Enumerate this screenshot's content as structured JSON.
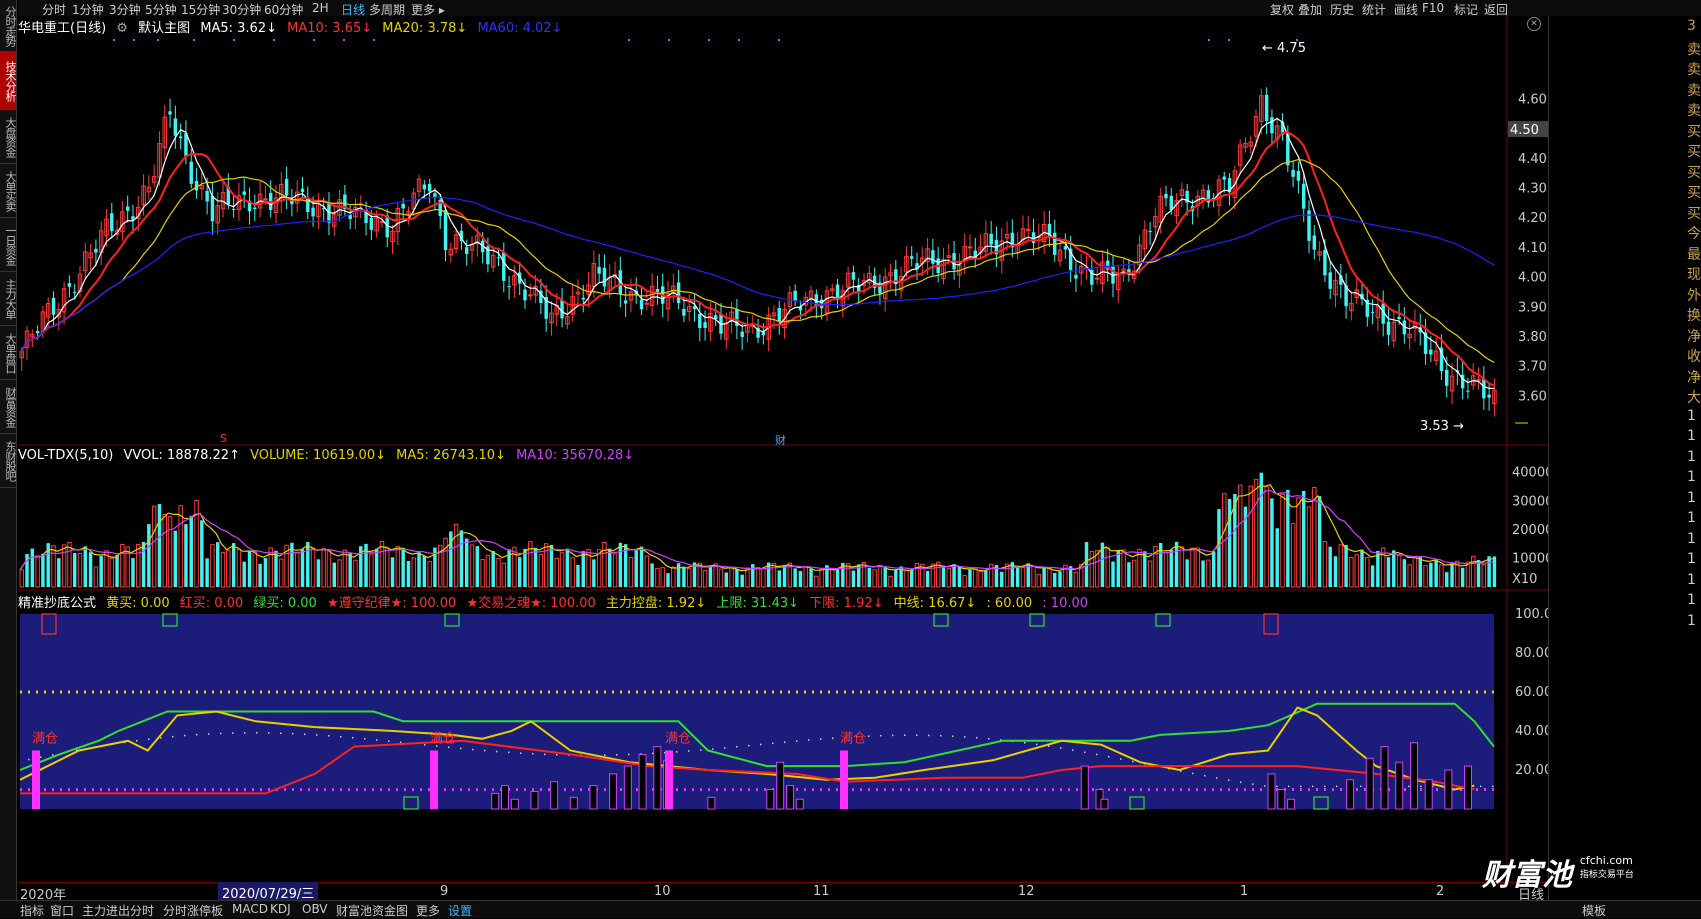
{
  "left_tabs": [
    {
      "label": "分时走势",
      "active": false
    },
    {
      "label": "技术分析",
      "active": true
    },
    {
      "label": "大盘资金",
      "active": false
    },
    {
      "label": "大单买卖",
      "active": false
    },
    {
      "label": "一日资金",
      "active": false
    },
    {
      "label": "主力大单",
      "active": false
    },
    {
      "label": "大单盘口",
      "active": false
    },
    {
      "label": "财富资金",
      "active": false
    },
    {
      "label": "东财股吧",
      "active": false
    }
  ],
  "periods": [
    {
      "label": "分时",
      "active": false
    },
    {
      "label": "1分钟",
      "active": false
    },
    {
      "label": "3分钟",
      "active": false
    },
    {
      "label": "5分钟",
      "active": false
    },
    {
      "label": "15分钟",
      "active": false
    },
    {
      "label": "30分钟",
      "active": false
    },
    {
      "label": "60分钟",
      "active": false
    },
    {
      "label": "2H",
      "active": false
    },
    {
      "label": "日线",
      "active": true
    },
    {
      "label": "多周期",
      "active": false
    },
    {
      "label": "更多 ▸",
      "active": false
    }
  ],
  "toolbar_right": [
    "复权",
    "叠加",
    "历史",
    "统计",
    "画线",
    "F10",
    "标记",
    "返回"
  ],
  "main_legend": {
    "stock": "华电重工(日线)",
    "chart_mode": "默认主图",
    "ma5": "MA5: 3.62↓",
    "ma10": "MA10: 3.65↓",
    "ma20": "MA20: 3.78↓",
    "ma60": "MA60: 4.02↓"
  },
  "price_axis": [
    "4.60",
    "4.50",
    "4.40",
    "4.30",
    "4.20",
    "4.10",
    "4.00",
    "3.90",
    "3.80",
    "3.70",
    "3.60"
  ],
  "price_current": "4.50",
  "annotations": {
    "high": "4.75",
    "low": "3.53",
    "s_mark": "S",
    "cai_mark": "财"
  },
  "vol_legend": {
    "name": "VOL-TDX(5,10)",
    "vvol": "VVOL: 18878.22↑",
    "volume": "VOLUME: 10619.00↓",
    "ma5": "MA5: 26743.10↓",
    "ma10": "MA10: 35670.28↓"
  },
  "vol_axis": [
    "40000",
    "30000",
    "20000",
    "10000",
    "X10"
  ],
  "ind_legend": {
    "name": "精准抄底公式",
    "huang": "黄买: 0.00",
    "hong": "红买: 0.00",
    "lv": "绿买: 0.00",
    "zun": "★遵守纪律★: 100.00",
    "hun": "★交易之魂★: 100.00",
    "zhuli": "主力控盘: 1.92↓",
    "shang": "上限: 31.43↓",
    "xia": "下限: 1.92↓",
    "zhong": "中线: 16.67↓",
    "sixty": ": 60.00",
    "ten": ": 10.00"
  },
  "ind_axis": [
    "100.0",
    "80.00",
    "60.00",
    "40.00",
    "20.00"
  ],
  "mancang_label": "满仓",
  "x_axis": [
    "2020年",
    "9",
    "10",
    "11",
    "12",
    "1",
    "2"
  ],
  "date_box": "2020/07/29/三",
  "x_extra": "日线",
  "bottom_tabs": [
    {
      "label": "指标",
      "active": false
    },
    {
      "label": "窗口",
      "active": false
    },
    {
      "label": "主力进出分时",
      "active": false
    },
    {
      "label": "分时涨停板",
      "active": false
    },
    {
      "label": "MACD",
      "active": false
    },
    {
      "label": "KDJ",
      "active": false
    },
    {
      "label": "OBV",
      "active": false
    },
    {
      "label": "财富池资金图",
      "active": false
    },
    {
      "label": "更多",
      "active": false
    },
    {
      "label": "设置",
      "active": true
    }
  ],
  "bottom_right": "模板",
  "right_panel_chars": [
    "3",
    "卖",
    "卖",
    "卖",
    "卖",
    "买",
    "买",
    "买",
    "买",
    "买",
    "今",
    "最",
    "现",
    "外",
    "换",
    "净",
    "收",
    "净",
    "大",
    "1",
    "1",
    "1",
    "1",
    "1",
    "1",
    "1",
    "1",
    "1",
    "1",
    "1"
  ],
  "watermark": {
    "cn": "财富池",
    "url": "cfchi.com",
    "sub": "指标交易平台"
  },
  "colors": {
    "up": "#ff3b3b",
    "down": "#3ff3f3",
    "ma5": "#ffffff",
    "ma10": "#ff2020",
    "ma20": "#e8d000",
    "ma60": "#2020ff",
    "panel": "#1c1c7a",
    "accent": "#38b8ff"
  }
}
